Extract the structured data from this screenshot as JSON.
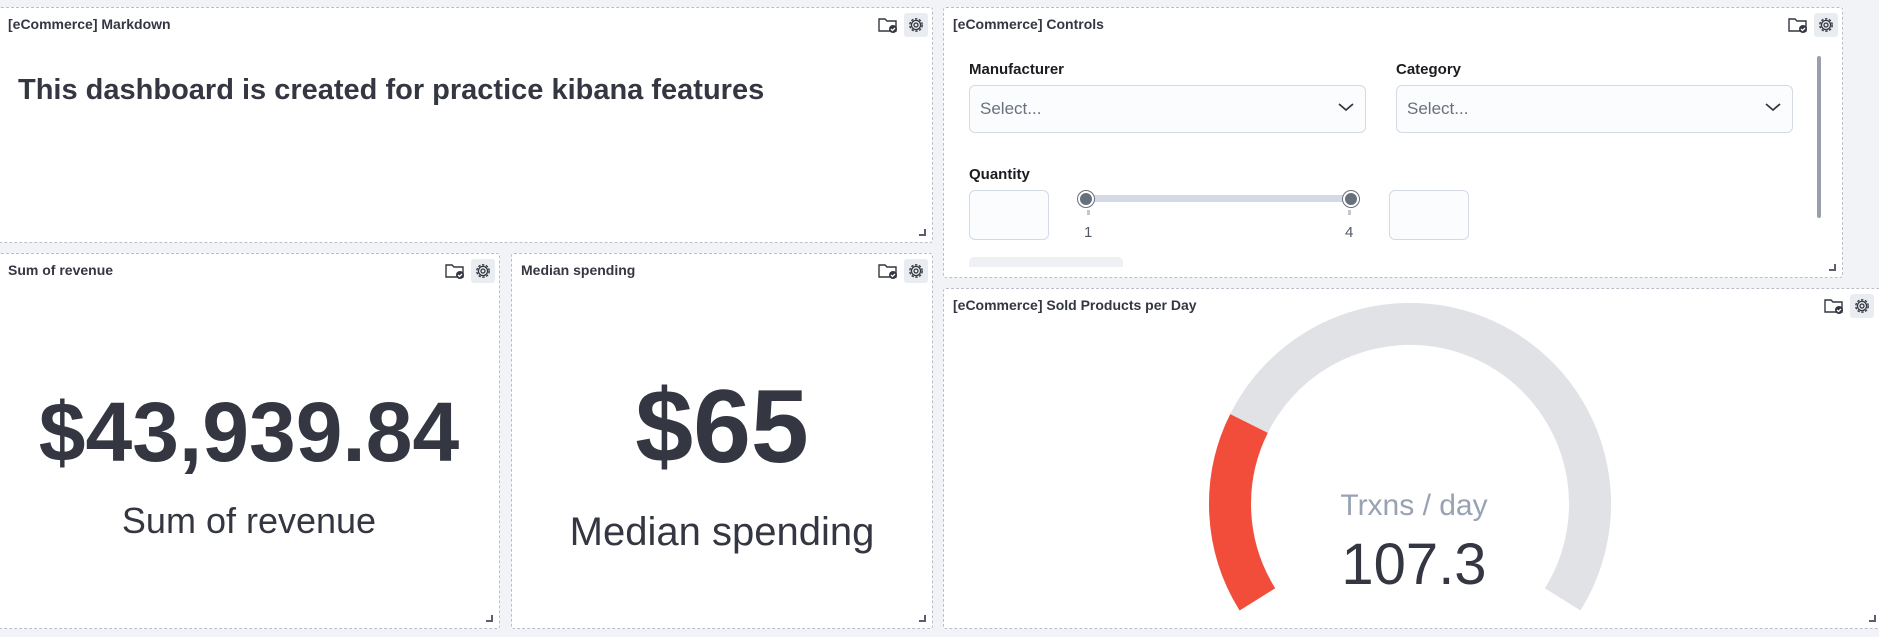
{
  "markdown_panel": {
    "title": "[eCommerce] Markdown",
    "heading": "This dashboard is created for practice kibana features"
  },
  "controls_panel": {
    "title": "[eCommerce] Controls",
    "manufacturer": {
      "label": "Manufacturer",
      "placeholder": "Select..."
    },
    "category": {
      "label": "Category",
      "placeholder": "Select..."
    },
    "quantity": {
      "label": "Quantity",
      "min_value": "",
      "max_value": "",
      "range_low": "1",
      "range_high": "4"
    }
  },
  "revenue_panel": {
    "title": "Sum of revenue",
    "value": "$43,939.84",
    "label": "Sum of revenue"
  },
  "median_panel": {
    "title": "Median spending",
    "value": "$65",
    "label": "Median spending"
  },
  "gauge_panel": {
    "title": "[eCommerce] Sold Products per Day",
    "label": "Trxns / day",
    "value": "107.3",
    "fill_fraction": 0.24,
    "fill_color": "#f24d3a",
    "track_color": "#e0e2e6"
  },
  "icons": {
    "folder": "folder-check-icon",
    "gear": "gear-icon",
    "dropdown": "chevron-down-icon"
  }
}
